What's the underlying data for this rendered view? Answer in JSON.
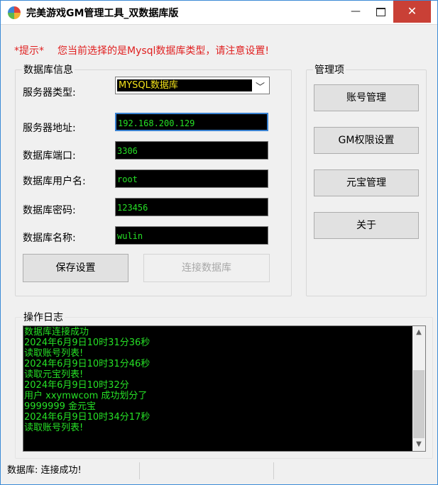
{
  "window": {
    "title": "完美游戏GM管理工具_双数据库版",
    "minimize": "—",
    "maximize": "□",
    "close": "✕"
  },
  "hint": {
    "star": "*提示*",
    "text": "您当前选择的是Mysql数据库类型，请注意设置!"
  },
  "db_group": {
    "title": "数据库信息",
    "server_type_label": "服务器类型:",
    "server_type_value": "MYSQL数据库",
    "server_addr_label": "服务器地址:",
    "server_addr_value": "192.168.200.129",
    "port_label": "数据库端口:",
    "port_value": "3306",
    "user_label": "数据库用户名:",
    "user_value": "root",
    "password_label": "数据库密码:",
    "password_value": "123456",
    "dbname_label": "数据库名称:",
    "dbname_value": "wulin",
    "save_button": "保存设置",
    "connect_button": "连接数据库"
  },
  "manage_group": {
    "title": "管理项",
    "buttons": [
      "账号管理",
      "GM权限设置",
      "元宝管理",
      "关于"
    ]
  },
  "log": {
    "title": "操作日志",
    "lines": [
      "数据库连接成功",
      "2024年6月9日10时31分36秒",
      "读取账号列表!",
      "2024年6月9日10时31分46秒",
      "读取元宝列表!",
      "2024年6月9日10时32分",
      "用户 xxymwcom 成功划分了",
      "9999999 金元宝",
      "2024年6月9日10时34分17秒",
      "读取账号列表!"
    ]
  },
  "status": {
    "text": "数据库: 连接成功!"
  },
  "colors": {
    "log_text": "#26e026",
    "hint_text": "#e02020",
    "select_text": "#f3e21a",
    "close_button": "#c94036"
  }
}
